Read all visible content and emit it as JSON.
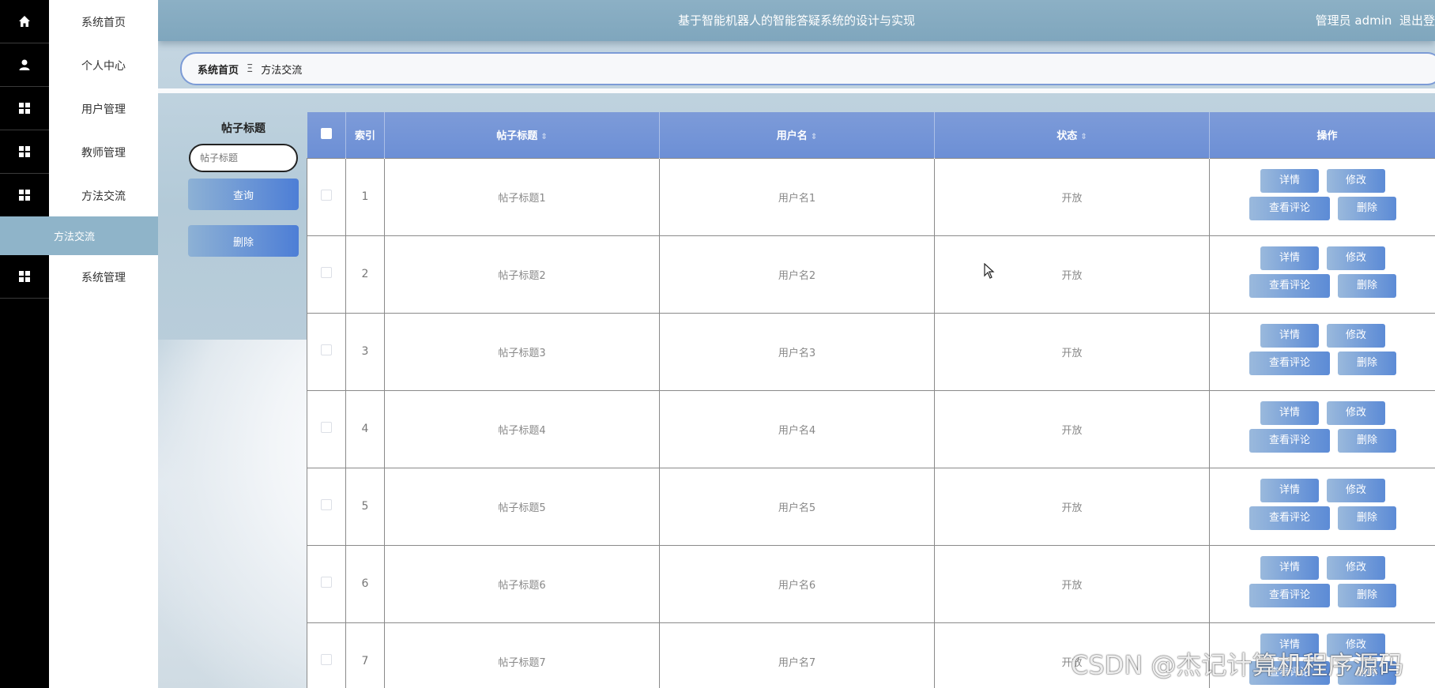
{
  "sidebar": {
    "items": [
      {
        "label": "系统首页",
        "icon": "home-icon"
      },
      {
        "label": "个人中心",
        "icon": "user-icon"
      },
      {
        "label": "用户管理",
        "icon": "grid-icon"
      },
      {
        "label": "教师管理",
        "icon": "grid-icon"
      },
      {
        "label": "方法交流",
        "icon": "grid-icon"
      },
      {
        "label": "系统管理",
        "icon": "grid-icon"
      }
    ],
    "active_subitem": "方法交流"
  },
  "header": {
    "title": "基于智能机器人的智能答疑系统的设计与实现",
    "user": "管理员 admin",
    "logout": "退出登"
  },
  "breadcrumb": {
    "home": "系统首页",
    "separator": "Ξ",
    "current": "方法交流"
  },
  "search": {
    "label": "帖子标题",
    "placeholder": "帖子标题",
    "query_button": "查询",
    "delete_button": "删除"
  },
  "table": {
    "headers": {
      "index": "索引",
      "title": "帖子标题",
      "username": "用户名",
      "status": "状态",
      "actions": "操作"
    },
    "rows": [
      {
        "index": "1",
        "title": "帖子标题1",
        "username": "用户名1",
        "status": "开放"
      },
      {
        "index": "2",
        "title": "帖子标题2",
        "username": "用户名2",
        "status": "开放"
      },
      {
        "index": "3",
        "title": "帖子标题3",
        "username": "用户名3",
        "status": "开放"
      },
      {
        "index": "4",
        "title": "帖子标题4",
        "username": "用户名4",
        "status": "开放"
      },
      {
        "index": "5",
        "title": "帖子标题5",
        "username": "用户名5",
        "status": "开放"
      },
      {
        "index": "6",
        "title": "帖子标题6",
        "username": "用户名6",
        "status": "开放"
      },
      {
        "index": "7",
        "title": "帖子标题7",
        "username": "用户名7",
        "status": "开放"
      }
    ],
    "actions": {
      "detail": "详情",
      "edit": "修改",
      "comments": "查看评论",
      "delete": "删除"
    }
  },
  "watermark": "CSDN @杰记计算机程序源码",
  "colors": {
    "header_bar": "#7fa6bd",
    "table_header": "#6c8fd6",
    "sidebar_strip": "#000000",
    "active_subitem": "#8fb4c9"
  }
}
